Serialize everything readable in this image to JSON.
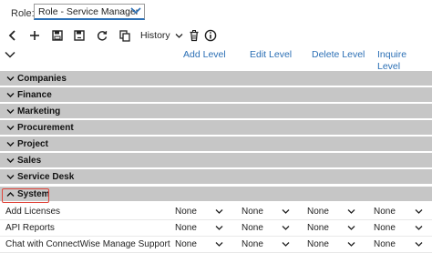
{
  "role": {
    "label": "Role:",
    "value": "Role - Service Manager"
  },
  "toolbar": {
    "history_label": "History",
    "icons": [
      "back-icon",
      "add-icon",
      "save-icon",
      "save-as-icon",
      "refresh-icon",
      "copy-icon",
      "delete-icon",
      "info-icon"
    ]
  },
  "columns": {
    "add": "Add Level",
    "edit": "Edit Level",
    "delete": "Delete Level",
    "inquire": "Inquire Level"
  },
  "groups": [
    {
      "label": "Companies",
      "expanded": false
    },
    {
      "label": "Finance",
      "expanded": false
    },
    {
      "label": "Marketing",
      "expanded": false
    },
    {
      "label": "Procurement",
      "expanded": false
    },
    {
      "label": "Project",
      "expanded": false
    },
    {
      "label": "Sales",
      "expanded": false
    },
    {
      "label": "Service Desk",
      "expanded": false
    },
    {
      "label": "System",
      "expanded": true,
      "highlighted": true
    }
  ],
  "permissions": [
    {
      "label": "Add Licenses",
      "add": "None",
      "edit": "None",
      "delete": "None",
      "inquire": "None"
    },
    {
      "label": "API Reports",
      "add": "None",
      "edit": "None",
      "delete": "None",
      "inquire": "None"
    },
    {
      "label": "Chat with ConnectWise Manage Support",
      "add": "None",
      "edit": "None",
      "delete": "None",
      "inquire": "None"
    }
  ],
  "colors": {
    "accent": "#2b6fb5",
    "group_bg": "#c6c6c6",
    "highlight": "#e0453b"
  }
}
